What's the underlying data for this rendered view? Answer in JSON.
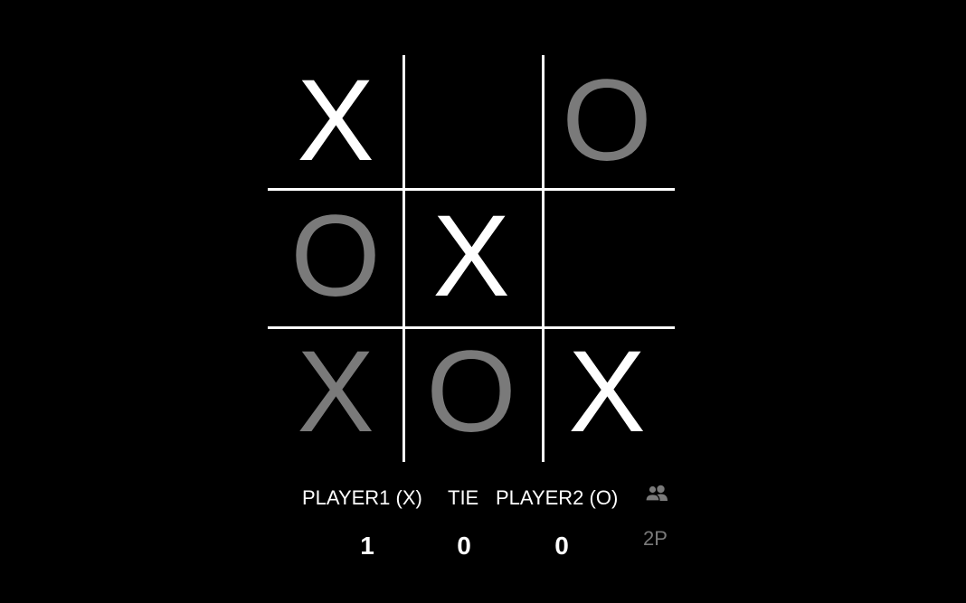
{
  "board": {
    "cells": [
      {
        "mark": "X",
        "color": "#ffffff"
      },
      {
        "mark": "",
        "color": "#ffffff"
      },
      {
        "mark": "O",
        "color": "#7a7a7a"
      },
      {
        "mark": "O",
        "color": "#7a7a7a"
      },
      {
        "mark": "X",
        "color": "#ffffff"
      },
      {
        "mark": "",
        "color": "#ffffff"
      },
      {
        "mark": "X",
        "color": "#7a7a7a"
      },
      {
        "mark": "O",
        "color": "#7a7a7a"
      },
      {
        "mark": "X",
        "color": "#ffffff"
      }
    ]
  },
  "scoreboard": {
    "player1_label": "PLAYER1 (X)",
    "tie_label": "TIE",
    "player2_label": "PLAYER2 (O)",
    "player1_score": "1",
    "tie_score": "0",
    "player2_score": "0"
  },
  "mode": {
    "icon": "two-users-icon",
    "label": "2P"
  },
  "colors": {
    "background": "#000000",
    "primary": "#ffffff",
    "dim": "#7a7a7a"
  }
}
